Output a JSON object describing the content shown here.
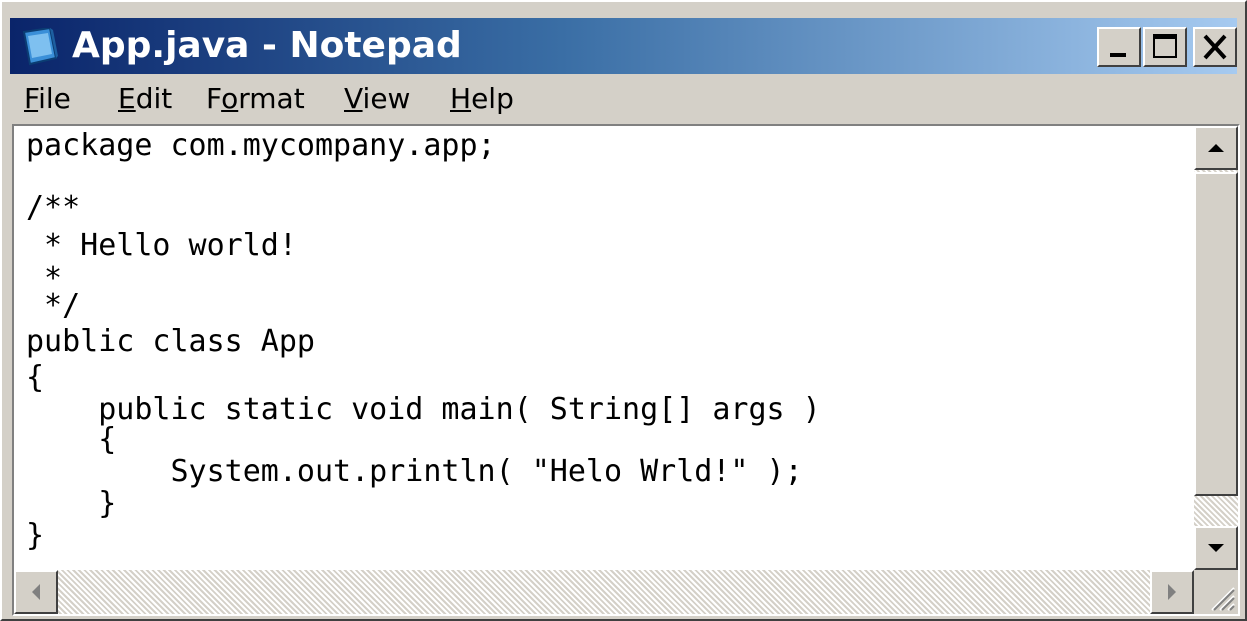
{
  "window": {
    "title": "App.java - Notepad",
    "icon": "notepad-icon"
  },
  "titlebar_buttons": {
    "minimize": "minimize-icon",
    "maximize": "maximize-icon",
    "close": "close-icon"
  },
  "menu": {
    "items": [
      {
        "mnemonic": "F",
        "rest": "ile"
      },
      {
        "mnemonic": "E",
        "rest": "dit"
      },
      {
        "before": "F",
        "mnemonic": "o",
        "rest": "rmat"
      },
      {
        "mnemonic": "V",
        "rest": "iew"
      },
      {
        "mnemonic": "H",
        "rest": "elp"
      }
    ]
  },
  "editor": {
    "lines": [
      "package com.mycompany.app;",
      "/**",
      " * Hello world!",
      " *",
      " */",
      "public class App",
      "{",
      "    public static void main( String[] args )",
      "    {",
      "        System.out.println( \"Helo Wrld!\" );",
      "    }",
      "}"
    ]
  },
  "colors": {
    "titlebar_start": "#0a246a",
    "titlebar_end": "#a6caf0",
    "chrome": "#d4d0c8"
  },
  "scrollbars": {
    "up": "arrow-up-icon",
    "down": "arrow-down-icon",
    "left": "arrow-left-icon",
    "right": "arrow-right-icon"
  }
}
